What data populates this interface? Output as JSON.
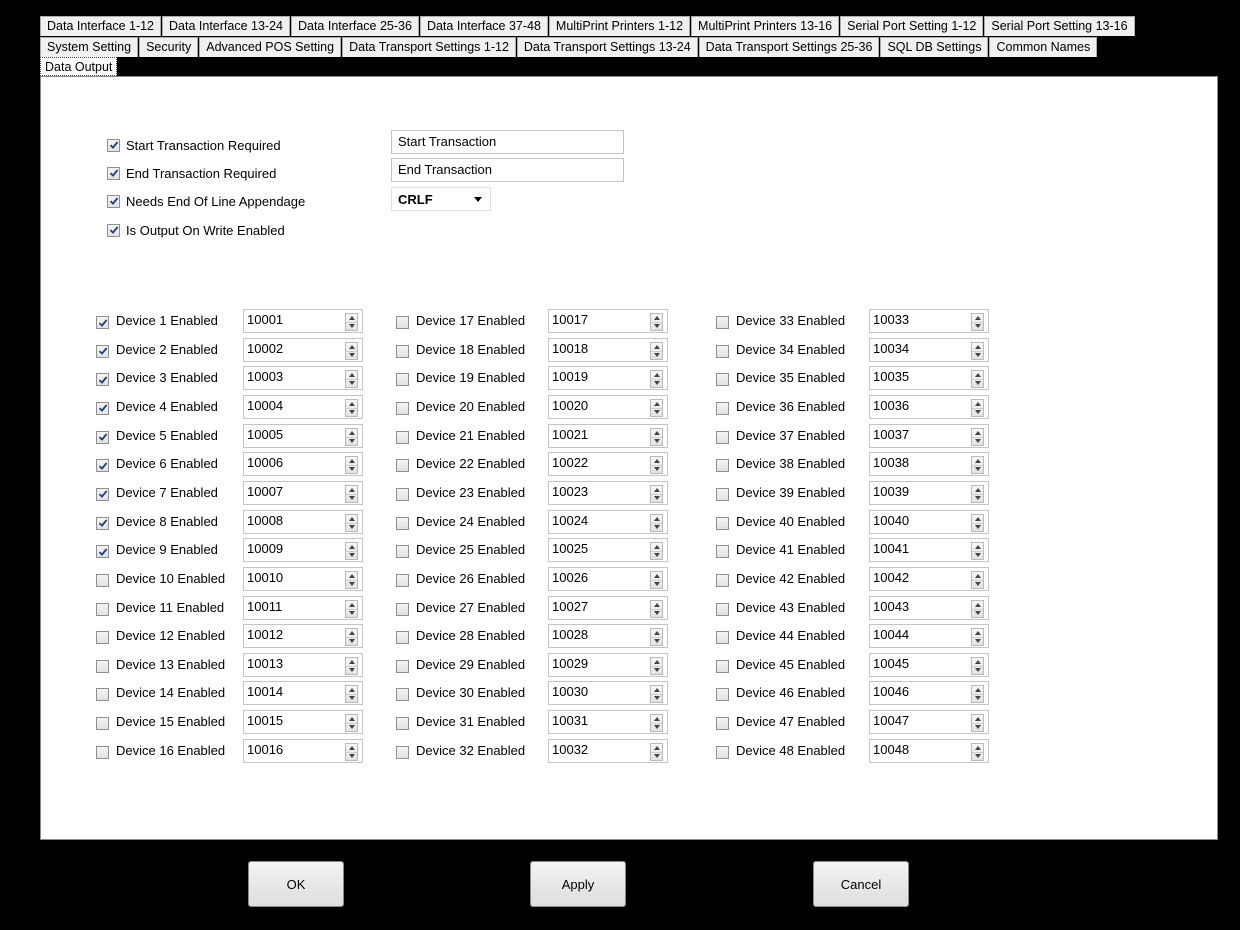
{
  "tabs": {
    "row1": [
      "Data Interface 1-12",
      "Data Interface 13-24",
      "Data Interface 25-36",
      "Data Interface 37-48",
      "MultiPrint Printers 1-12",
      "MultiPrint Printers 13-16",
      "Serial Port Setting 1-12",
      "Serial Port Setting 13-16"
    ],
    "row2": [
      "System Setting",
      "Security",
      "Advanced POS Setting",
      "Data Transport Settings 1-12",
      "Data Transport Settings 13-24",
      "Data Transport Settings 25-36",
      "SQL DB Settings",
      "Common Names"
    ],
    "row3": [
      "Data Output"
    ],
    "active": "Data Output"
  },
  "options": [
    {
      "label": "Start Transaction Required",
      "checked": true
    },
    {
      "label": "End Transaction Required",
      "checked": true
    },
    {
      "label": "Needs End Of Line Appendage",
      "checked": true
    },
    {
      "label": "Is Output On Write Enabled",
      "checked": true
    }
  ],
  "start_transaction_text": "Start Transaction",
  "end_transaction_text": "End Transaction",
  "line_ending": {
    "selected": "CRLF"
  },
  "devices": [
    {
      "label": "Device 1 Enabled",
      "checked": true,
      "value": "10001"
    },
    {
      "label": "Device 2 Enabled",
      "checked": true,
      "value": "10002"
    },
    {
      "label": "Device 3 Enabled",
      "checked": true,
      "value": "10003"
    },
    {
      "label": "Device 4 Enabled",
      "checked": true,
      "value": "10004"
    },
    {
      "label": "Device 5 Enabled",
      "checked": true,
      "value": "10005"
    },
    {
      "label": "Device 6 Enabled",
      "checked": true,
      "value": "10006"
    },
    {
      "label": "Device 7 Enabled",
      "checked": true,
      "value": "10007"
    },
    {
      "label": "Device 8 Enabled",
      "checked": true,
      "value": "10008"
    },
    {
      "label": "Device 9 Enabled",
      "checked": true,
      "value": "10009"
    },
    {
      "label": "Device 10 Enabled",
      "checked": false,
      "value": "10010"
    },
    {
      "label": "Device 11 Enabled",
      "checked": false,
      "value": "10011"
    },
    {
      "label": "Device 12 Enabled",
      "checked": false,
      "value": "10012"
    },
    {
      "label": "Device 13 Enabled",
      "checked": false,
      "value": "10013"
    },
    {
      "label": "Device 14 Enabled",
      "checked": false,
      "value": "10014"
    },
    {
      "label": "Device 15 Enabled",
      "checked": false,
      "value": "10015"
    },
    {
      "label": "Device 16 Enabled",
      "checked": false,
      "value": "10016"
    },
    {
      "label": "Device 17 Enabled",
      "checked": false,
      "value": "10017"
    },
    {
      "label": "Device 18 Enabled",
      "checked": false,
      "value": "10018"
    },
    {
      "label": "Device 19 Enabled",
      "checked": false,
      "value": "10019"
    },
    {
      "label": "Device 20 Enabled",
      "checked": false,
      "value": "10020"
    },
    {
      "label": "Device 21 Enabled",
      "checked": false,
      "value": "10021"
    },
    {
      "label": "Device 22 Enabled",
      "checked": false,
      "value": "10022"
    },
    {
      "label": "Device 23 Enabled",
      "checked": false,
      "value": "10023"
    },
    {
      "label": "Device 24 Enabled",
      "checked": false,
      "value": "10024"
    },
    {
      "label": "Device 25 Enabled",
      "checked": false,
      "value": "10025"
    },
    {
      "label": "Device 26 Enabled",
      "checked": false,
      "value": "10026"
    },
    {
      "label": "Device 27 Enabled",
      "checked": false,
      "value": "10027"
    },
    {
      "label": "Device 28 Enabled",
      "checked": false,
      "value": "10028"
    },
    {
      "label": "Device 29 Enabled",
      "checked": false,
      "value": "10029"
    },
    {
      "label": "Device 30 Enabled",
      "checked": false,
      "value": "10030"
    },
    {
      "label": "Device 31 Enabled",
      "checked": false,
      "value": "10031"
    },
    {
      "label": "Device 32 Enabled",
      "checked": false,
      "value": "10032"
    },
    {
      "label": "Device 33 Enabled",
      "checked": false,
      "value": "10033"
    },
    {
      "label": "Device 34 Enabled",
      "checked": false,
      "value": "10034"
    },
    {
      "label": "Device 35 Enabled",
      "checked": false,
      "value": "10035"
    },
    {
      "label": "Device 36 Enabled",
      "checked": false,
      "value": "10036"
    },
    {
      "label": "Device 37 Enabled",
      "checked": false,
      "value": "10037"
    },
    {
      "label": "Device 38 Enabled",
      "checked": false,
      "value": "10038"
    },
    {
      "label": "Device 39 Enabled",
      "checked": false,
      "value": "10039"
    },
    {
      "label": "Device 40 Enabled",
      "checked": false,
      "value": "10040"
    },
    {
      "label": "Device 41 Enabled",
      "checked": false,
      "value": "10041"
    },
    {
      "label": "Device 42 Enabled",
      "checked": false,
      "value": "10042"
    },
    {
      "label": "Device 43 Enabled",
      "checked": false,
      "value": "10043"
    },
    {
      "label": "Device 44 Enabled",
      "checked": false,
      "value": "10044"
    },
    {
      "label": "Device 45 Enabled",
      "checked": false,
      "value": "10045"
    },
    {
      "label": "Device 46 Enabled",
      "checked": false,
      "value": "10046"
    },
    {
      "label": "Device 47 Enabled",
      "checked": false,
      "value": "10047"
    },
    {
      "label": "Device 48 Enabled",
      "checked": false,
      "value": "10048"
    }
  ],
  "buttons": {
    "ok": "OK",
    "apply": "Apply",
    "cancel": "Cancel"
  },
  "colors": {
    "background": "#000000",
    "panel": "#ffffff",
    "tab": "#f0f0f0",
    "check": "#1f3f7a"
  }
}
